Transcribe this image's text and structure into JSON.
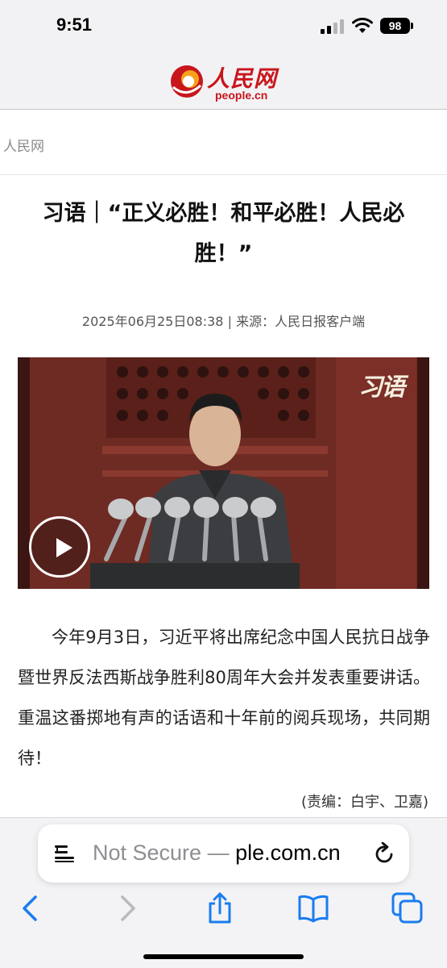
{
  "status_bar": {
    "time": "9:51",
    "battery": "98"
  },
  "site": {
    "logo_cn": "人民网",
    "logo_en": "people.cn"
  },
  "breadcrumb": "人民网",
  "article": {
    "title": "习语｜“正义必胜！和平必胜！人民必胜！”",
    "datetime": "2025年06月25日08:38",
    "source": "来源：人民日报客户端",
    "video_watermark": "习语",
    "body": "今年9月3日，习近平将出席纪念中国人民抗日战争暨世界反法西斯战争胜利80周年大会并发表重要讲话。重温这番掷地有声的话语和十年前的阅兵现场，共同期待！",
    "editor": "(责编：白宇、卫嘉)"
  },
  "browser": {
    "url_prefix": "Not Secure — ",
    "url_domain": "ple.com.cn"
  },
  "icons": [
    "signal-icon",
    "wifi-icon",
    "battery-icon",
    "reader-icon",
    "reload-icon",
    "back-icon",
    "forward-icon",
    "share-icon",
    "bookmarks-icon",
    "tabs-icon",
    "play-icon"
  ],
  "colors": {
    "brand_red": "#c8161d",
    "link_blue": "#1a7cf0",
    "video_bg": "#6b2a24"
  }
}
